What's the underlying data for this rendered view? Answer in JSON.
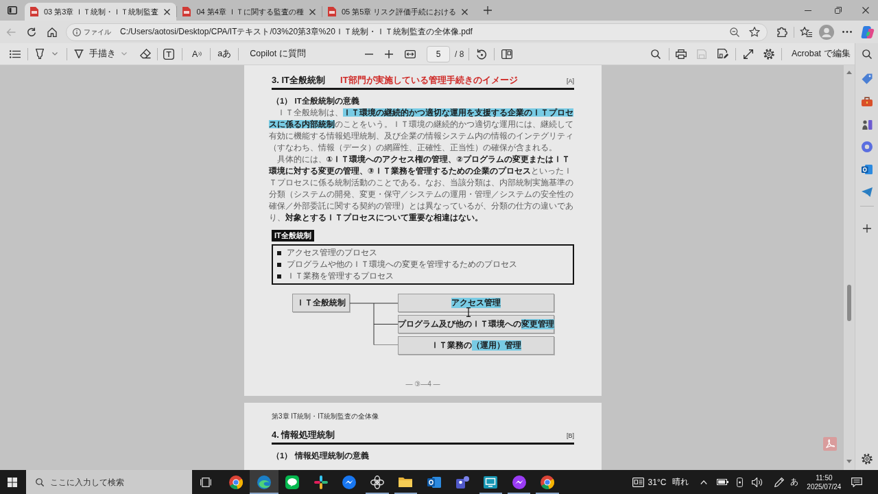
{
  "window": {
    "tabs": [
      {
        "title": "03 第3章 ＩＴ統制・ＩＴ統制監査",
        "selected": true
      },
      {
        "title": "04 第4章 ＩＴに関する監査の種",
        "selected": false
      },
      {
        "title": "05 第5章 リスク評価手続における",
        "selected": false
      }
    ]
  },
  "address_bar": {
    "scheme": "ファイル",
    "url": "C:/Users/aotosi/Desktop/CPA/ITテキスト/03%20第3章%20ＩＴ統制・ＩＴ統制監査の全体像.pdf"
  },
  "pdf_toolbar": {
    "draw_label": "手描き",
    "read_aloud_glyph": "A",
    "translate_glyph": "aあ",
    "copilot_label": "Copilot に質問",
    "page": "5",
    "page_count": "/ 8",
    "edit_label": "Acrobat で編集"
  },
  "document": {
    "pages": [
      {
        "heading": "3. IT全般統制",
        "annotation": "IT部門が実施している管理手続きのイメージ",
        "rank": "[A]",
        "subheading": "（1） IT全般統制の意義",
        "paragraphs": [
          {
            "runs": [
              {
                "text": "ＩＴ全般統制は、",
                "bold": false,
                "highlighted": false
              },
              {
                "text": "ＩＴ環境の継続的かつ適切な運用を支援する企業のＩＴプロセスに係る内部統制",
                "bold": true,
                "highlighted": true
              },
              {
                "text": "のことをいう。ＩＴ環境の継続的かつ適切な運用には、継続して有効に機能する情報処理統制、及び企業の情報システム内の情報のインテグリティ（すなわち、情報（データ）の網羅性、正確性、正当性）の確保が含まれる。",
                "bold": false,
                "highlighted": false
              }
            ]
          },
          {
            "runs": [
              {
                "text": "具体的には、",
                "bold": false,
                "highlighted": false
              },
              {
                "text": "①ＩＴ環境へのアクセス権の管理、②プログラムの変更またはＩＴ環境に対する変更の管理、③ＩＴ業務を管理するための企業のプロセス",
                "bold": true,
                "highlighted": false
              },
              {
                "text": "といったＩＴプロセスに係る統制活動のことである。なお、当該分類は、内部統制実施基準の分類（システムの開発、変更・保守／システムの運用・管理／システムの安全性の確保／外部委託に関する契約の管理）とは異なっているが、分類の仕方の違いであり、",
                "bold": false,
                "highlighted": false
              },
              {
                "text": "対象とするＩＴプロセスについて重要な相違はない。",
                "bold": true,
                "highlighted": false
              }
            ]
          }
        ],
        "tag": "IT全般統制",
        "list_items": [
          "アクセス管理のプロセス",
          "プログラムや他のＩＴ環境への変更を管理するためのプロセス",
          "ＩＴ業務を管理するプロセス"
        ],
        "diagram": {
          "root": "ＩＴ全般統制",
          "children": [
            {
              "runs": [
                {
                  "text": "アクセス管理",
                  "highlighted": true
                }
              ]
            },
            {
              "runs": [
                {
                  "text": "プログラム及び他のＩＴ環境への",
                  "highlighted": false
                },
                {
                  "text": "変更管理",
                  "highlighted": true
                }
              ]
            },
            {
              "runs": [
                {
                  "text": "ＩＴ業務の",
                  "highlighted": false
                },
                {
                  "text": "（運用）管理",
                  "highlighted": true
                }
              ]
            }
          ]
        },
        "page_number": "― ③―4 ―"
      },
      {
        "running_header": "第3章 IT統制・IT統制監査の全体像",
        "heading": "4. 情報処理統制",
        "rank": "[B]",
        "subheading": "（1） 情報処理統制の意義"
      }
    ]
  },
  "taskbar": {
    "search_placeholder": "ここに入力して検索",
    "apps": [
      {
        "running": false,
        "focused": false
      },
      {
        "running": true,
        "focused": true
      },
      {
        "running": false,
        "focused": false
      },
      {
        "running": false,
        "focused": false
      },
      {
        "running": false,
        "focused": false
      },
      {
        "running": true,
        "focused": false
      },
      {
        "running": true,
        "focused": false
      },
      {
        "running": false,
        "focused": false
      },
      {
        "running": false,
        "focused": false
      },
      {
        "running": true,
        "focused": false
      },
      {
        "running": true,
        "focused": false
      },
      {
        "running": true,
        "focused": false
      }
    ],
    "temperature": "31°C",
    "weather": "晴れ",
    "ime_mode": "あ",
    "time": "11:50",
    "date": "2025/07/24"
  }
}
